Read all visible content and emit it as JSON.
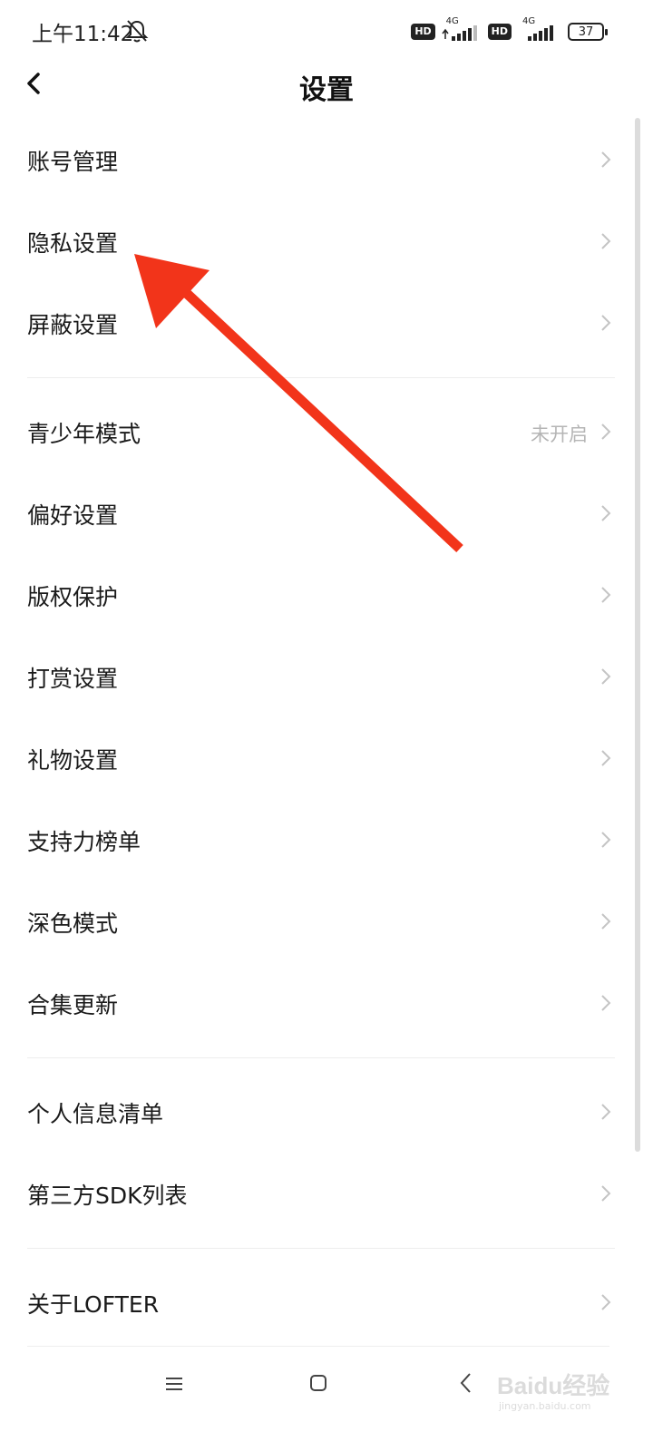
{
  "status_bar": {
    "time": "上午11:42",
    "hd_1": "HD",
    "net_1": "4G",
    "hd_2": "HD",
    "net_2": "4G",
    "battery": "37"
  },
  "header": {
    "title": "设置"
  },
  "settings": {
    "group1": [
      {
        "label": "账号管理"
      },
      {
        "label": "隐私设置"
      },
      {
        "label": "屏蔽设置"
      }
    ],
    "group2": [
      {
        "label": "青少年模式",
        "value": "未开启"
      },
      {
        "label": "偏好设置"
      },
      {
        "label": "版权保护"
      },
      {
        "label": "打赏设置"
      },
      {
        "label": "礼物设置"
      },
      {
        "label": "支持力榜单"
      },
      {
        "label": "深色模式"
      },
      {
        "label": "合集更新"
      }
    ],
    "group3": [
      {
        "label": "个人信息清单"
      },
      {
        "label": "第三方SDK列表"
      }
    ],
    "group4": [
      {
        "label": "关于LOFTER"
      }
    ]
  },
  "watermark": {
    "brand": "Baidu经验",
    "url": "jingyan.baidu.com"
  },
  "colors": {
    "arrow": "#f2341a",
    "chevron": "#c4c4c4",
    "secondary_text": "#b5b5b5"
  }
}
